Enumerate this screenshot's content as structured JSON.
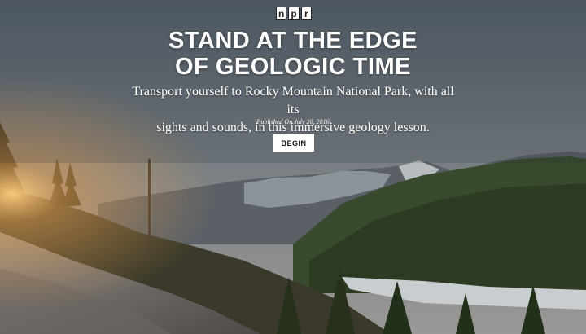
{
  "brand": {
    "logo_letters": [
      "n",
      "p",
      "r"
    ]
  },
  "hero": {
    "title_line1": "STAND AT THE EDGE",
    "title_line2": "OF GEOLOGIC TIME",
    "subtitle_line1": "Transport yourself to Rocky Mountain National Park, with all its",
    "subtitle_line2": "sights and sounds, in this immersive geology lesson.",
    "published": "Published On July 20, 2016",
    "begin_label": "BEGIN"
  },
  "colors": {
    "sky_top": "#5a646b",
    "sky_bottom": "#87898a",
    "mountain": "#4b5055",
    "forest": "#2e3a20",
    "sun": "#ffb040",
    "button_bg": "#ffffff"
  }
}
